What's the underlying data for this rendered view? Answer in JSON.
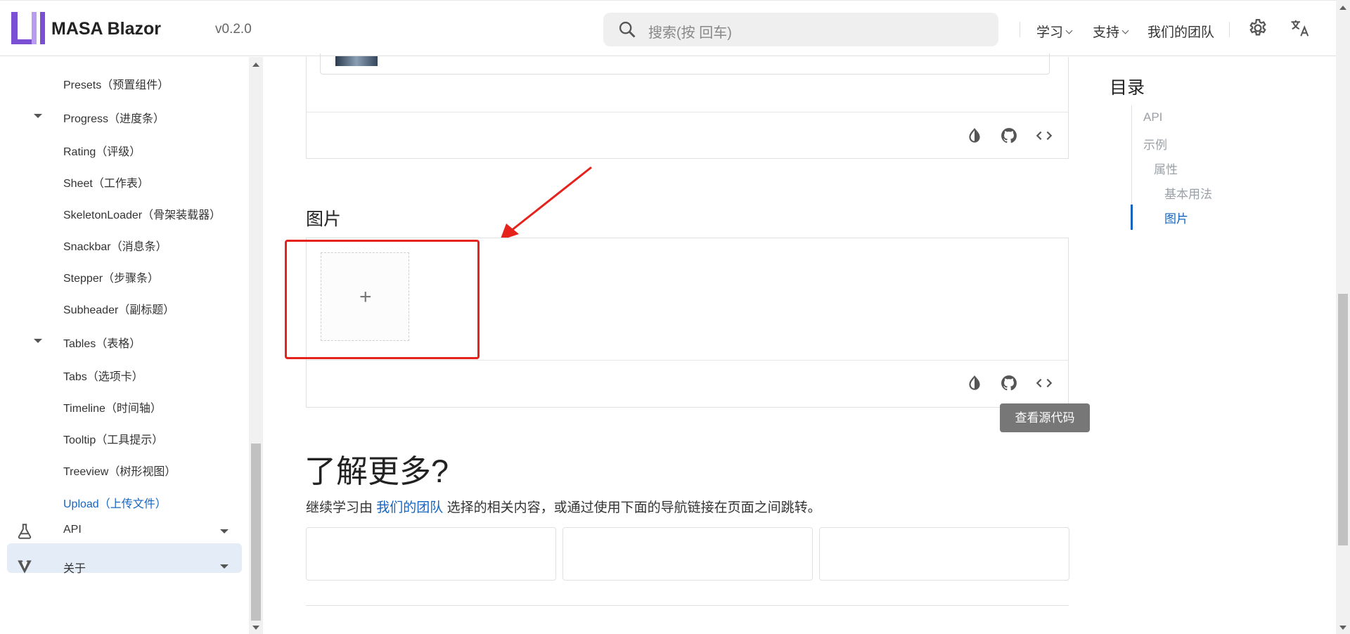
{
  "header": {
    "brand": "MASA Blazor",
    "version": "v0.2.0",
    "search_placeholder": "搜索(按 回车)",
    "nav": [
      {
        "label": "学习"
      },
      {
        "label": "支持"
      },
      {
        "label": "我们的团队"
      }
    ],
    "icons": [
      "settings-icon",
      "translate-icon"
    ]
  },
  "sidebar": {
    "items": [
      {
        "label": "Presets（预置组件）"
      },
      {
        "label": "Progress（进度条）",
        "expandable": true
      },
      {
        "label": "Rating（评级）"
      },
      {
        "label": "Sheet（工作表）"
      },
      {
        "label": "SkeletonLoader（骨架装载器）"
      },
      {
        "label": "Snackbar（消息条）"
      },
      {
        "label": "Stepper（步骤条）"
      },
      {
        "label": "Subheader（副标题）"
      },
      {
        "label": "Tables（表格）",
        "expandable": true
      },
      {
        "label": "Tabs（选项卡）"
      },
      {
        "label": "Timeline（时间轴）"
      },
      {
        "label": "Tooltip（工具提示）"
      },
      {
        "label": "Treeview（树形视图）"
      },
      {
        "label": "Upload（上传文件）",
        "active": true
      }
    ],
    "groups": [
      {
        "label": "API",
        "icon": "flask-icon"
      },
      {
        "label": "关于",
        "icon": "vuetify-logo-icon"
      }
    ]
  },
  "main": {
    "section_title": "图片",
    "toolbar_icons": [
      "theme-toggle-icon",
      "github-icon",
      "code-icon"
    ],
    "tooltip": "查看源代码",
    "learn_more": {
      "title": "了解更多?",
      "text_before": "继续学习由 ",
      "link": "我们的团队",
      "text_after": " 选择的相关内容，或通过使用下面的导航链接在页面之间跳转。"
    }
  },
  "toc": {
    "title": "目录",
    "items": [
      {
        "label": "API"
      },
      {
        "label": "示例"
      },
      {
        "label": "属性"
      },
      {
        "label": "基本用法"
      },
      {
        "label": "图片",
        "active": true
      }
    ]
  },
  "colors": {
    "accent": "#1565c0",
    "annotation": "#e6221c",
    "active_bg": "#e3ecf7"
  }
}
